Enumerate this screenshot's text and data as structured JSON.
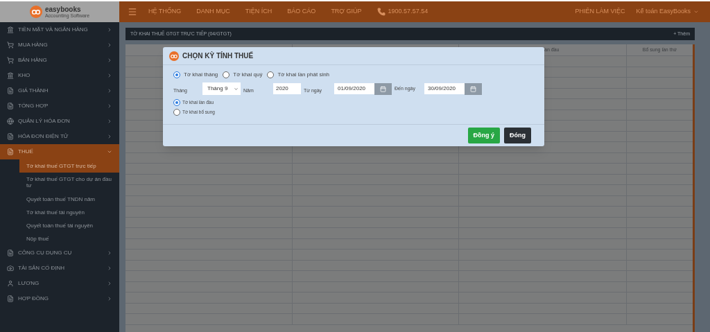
{
  "brand": {
    "name": "easybooks",
    "tagline": "Accounting Software"
  },
  "top_nav": {
    "menu": [
      "HỆ THỐNG",
      "DANH MỤC",
      "TIỆN ÍCH",
      "BÁO CÁO",
      "TRỢ GIÚP"
    ],
    "phone": "1900.57.57.54",
    "session": "PHIÊN LÀM VIỆC",
    "user": "Kế toán EasyBooks"
  },
  "sidebar": {
    "items": [
      {
        "kind": "bank",
        "label": "TIỀN MẶT VÀ NGÂN HÀNG",
        "selected": false,
        "expanded": false
      },
      {
        "kind": "cart",
        "label": "MUA HÀNG",
        "selected": false,
        "expanded": false
      },
      {
        "kind": "cart",
        "label": "BÁN HÀNG",
        "selected": false,
        "expanded": false
      },
      {
        "kind": "bank",
        "label": "KHO",
        "selected": false,
        "expanded": false
      },
      {
        "kind": "doc",
        "label": "GIÁ THÀNH",
        "selected": false,
        "expanded": false
      },
      {
        "kind": "doc",
        "label": "TỔNG HỢP",
        "selected": false,
        "expanded": false
      },
      {
        "kind": "globe",
        "label": "QUẢN LÝ HÓA ĐƠN",
        "selected": false,
        "expanded": false
      },
      {
        "kind": "doc",
        "label": "HÓA ĐƠN ĐIỆN TỬ",
        "selected": false,
        "expanded": false
      },
      {
        "kind": "doc",
        "label": "THUẾ",
        "selected": true,
        "expanded": true,
        "children": [
          {
            "label": "Tờ khai thuế GTGT trực tiếp",
            "selected": true
          },
          {
            "label": "Tờ khai thuế GTGT cho dự án đầu tư",
            "selected": false
          },
          {
            "label": "Quyết toán thuế TNDN năm",
            "selected": false
          },
          {
            "label": "Tờ khai thuế tài nguyên",
            "selected": false
          },
          {
            "label": "Quyết toán thuế tài nguyên",
            "selected": false
          },
          {
            "label": "Nộp thuế",
            "selected": false
          }
        ]
      },
      {
        "kind": "doc",
        "label": "CÔNG CỤ DỤNG CỤ",
        "selected": false,
        "expanded": false
      },
      {
        "kind": "camera",
        "label": "TÀI SẢN CỐ ĐỊNH",
        "selected": false,
        "expanded": false
      },
      {
        "kind": "user",
        "label": "LƯƠNG",
        "selected": false,
        "expanded": false
      },
      {
        "kind": "doc",
        "label": "HỢP ĐỒNG",
        "selected": false,
        "expanded": false
      }
    ]
  },
  "page": {
    "title": "TỜ KHAI THUẾ GTGT TRỰC TIẾP (04/GTGT)",
    "add_button": "+ Thêm"
  },
  "table": {
    "column_3": "ần đầu",
    "column_4": "Bổ sung lần thứ"
  },
  "modal": {
    "title": "CHỌN KỲ TÍNH THUẾ",
    "period_options": [
      {
        "label": "Tờ khai tháng",
        "selected": true
      },
      {
        "label": "Tờ khai quý",
        "selected": false
      },
      {
        "label": "Tờ khai lần phát sinh",
        "selected": false
      }
    ],
    "month_label": "Tháng",
    "month_value": "Tháng 9",
    "year_label": "Năm",
    "year_value": "2020",
    "from_label": "Từ ngày",
    "from_value": "01/09/2020",
    "to_label": "Đến ngày",
    "to_value": "30/09/2020",
    "declaration_types": [
      {
        "label": "Tờ khai lần đầu",
        "selected": true
      },
      {
        "label": "Tờ khai bổ sung",
        "selected": false
      }
    ],
    "buttons": [
      {
        "label": "Đồng ý",
        "kind": "primary"
      },
      {
        "label": "Đóng",
        "kind": "secondary"
      }
    ]
  }
}
